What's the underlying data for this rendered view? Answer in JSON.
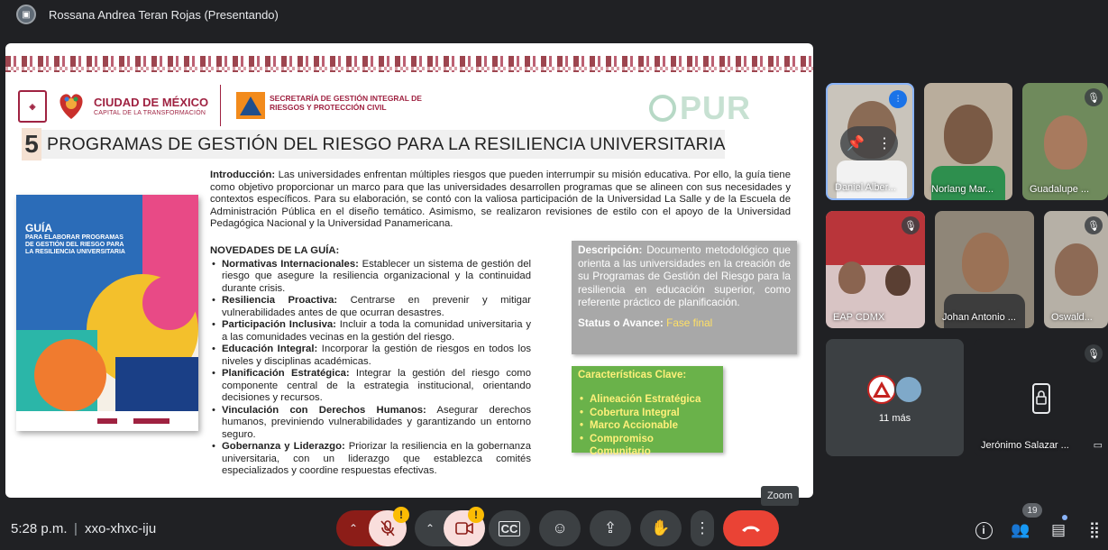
{
  "topbar": {
    "presenter_label": "Rossana Andrea Teran Rojas (Presentando)"
  },
  "slide": {
    "logo_cdmx": "CIUDAD DE MÉXICO",
    "logo_cdmx_sub": "CAPITAL DE LA TRANSFORMACIÓN",
    "logo_sgirpc": "SECRETARÍA DE GESTIÓN INTEGRAL DE RIESGOS Y PROTECCIÓN CIVIL",
    "logo_pur": "PUR",
    "title_number": "5",
    "title": "PROGRAMAS DE GESTIÓN DEL RIESGO PARA LA RESILIENCIA UNIVERSITARIA",
    "cover_title": "GUÍA",
    "cover_subtitle": "PARA ELABORAR PROGRAMAS DE GESTIÓN DEL RIESGO PARA LA RESILIENCIA UNIVERSITARIA",
    "intro_label": "Introducción:",
    "intro_text": " Las universidades enfrentan múltiples riesgos que pueden interrumpir su misión educativa. Por ello, la guía tiene como objetivo proporcionar un marco para que las universidades desarrollen programas que se alineen con sus necesidades y contextos específicos. Para su elaboración, se contó con la valiosa participación de la Universidad La Salle y de la Escuela de Administración Pública en el diseño temático. Asimismo, se realizaron revisiones de estilo con el apoyo de la Universidad Pedagógica Nacional y la Universidad Panamericana.",
    "novedades_title": "NOVEDADES DE LA GUÍA:",
    "novedades": [
      {
        "label": "Normativas Internacionales:",
        "text": " Establecer un sistema de gestión del riesgo que asegure la resiliencia organizacional y la continuidad durante crisis."
      },
      {
        "label": "Resiliencia Proactiva:",
        "text": " Centrarse en prevenir y mitigar vulnerabilidades antes de que ocurran desastres."
      },
      {
        "label": "Participación Inclusiva:",
        "text": " Incluir a toda la comunidad universitaria y a las comunidades vecinas en la gestión del riesgo."
      },
      {
        "label": "Educación Integral:",
        "text": " Incorporar la gestión de riesgos en todos los niveles y disciplinas académicas."
      },
      {
        "label": "Planificación Estratégica:",
        "text": " Integrar la gestión del riesgo como componente central de la estrategia institucional, orientando decisiones y recursos."
      },
      {
        "label": "Vinculación con Derechos Humanos:",
        "text": " Asegurar derechos humanos, previniendo vulnerabilidades y garantizando un entorno seguro."
      },
      {
        "label": "Gobernanza y Liderazgo:",
        "text": " Priorizar la resiliencia en la gobernanza universitaria, con un liderazgo que establezca comités especializados y coordine respuestas efectivas."
      }
    ],
    "desc_label": "Descripción:",
    "desc_text": " Documento metodológico que orienta a las universidades en la creación de su Programas de Gestión del Riesgo para la resiliencia en educación superior, como referente práctico de planificación.",
    "status_label": "Status o Avance:",
    "status_value": " Fase final",
    "features_title": "Características Clave:",
    "features": [
      "Alineación Estratégica",
      "Cobertura Integral",
      "Marco Accionable",
      "Compromiso Comunitario"
    ]
  },
  "participants": [
    {
      "name": "Daniel Alber..."
    },
    {
      "name": "Norlang Mar..."
    },
    {
      "name": "Guadalupe ..."
    },
    {
      "name": "EAP CDMX"
    },
    {
      "name": "Johan Antonio ..."
    },
    {
      "name": "Oswald..."
    },
    {
      "name": "11 más"
    },
    {
      "name": "Jerónimo Salazar ..."
    }
  ],
  "tooltip": {
    "zoom": "Zoom"
  },
  "bottom": {
    "time": "5:28 p.m.",
    "separator": "|",
    "meeting_code": "xxo-xhxc-iju",
    "people_count": "19"
  },
  "icons": [
    "mic-off-icon",
    "camera-icon",
    "captions-icon",
    "emoji-icon",
    "present-icon",
    "raise-hand-icon",
    "more-options-icon",
    "end-call-icon",
    "info-icon",
    "people-icon",
    "chat-icon",
    "activities-icon"
  ]
}
